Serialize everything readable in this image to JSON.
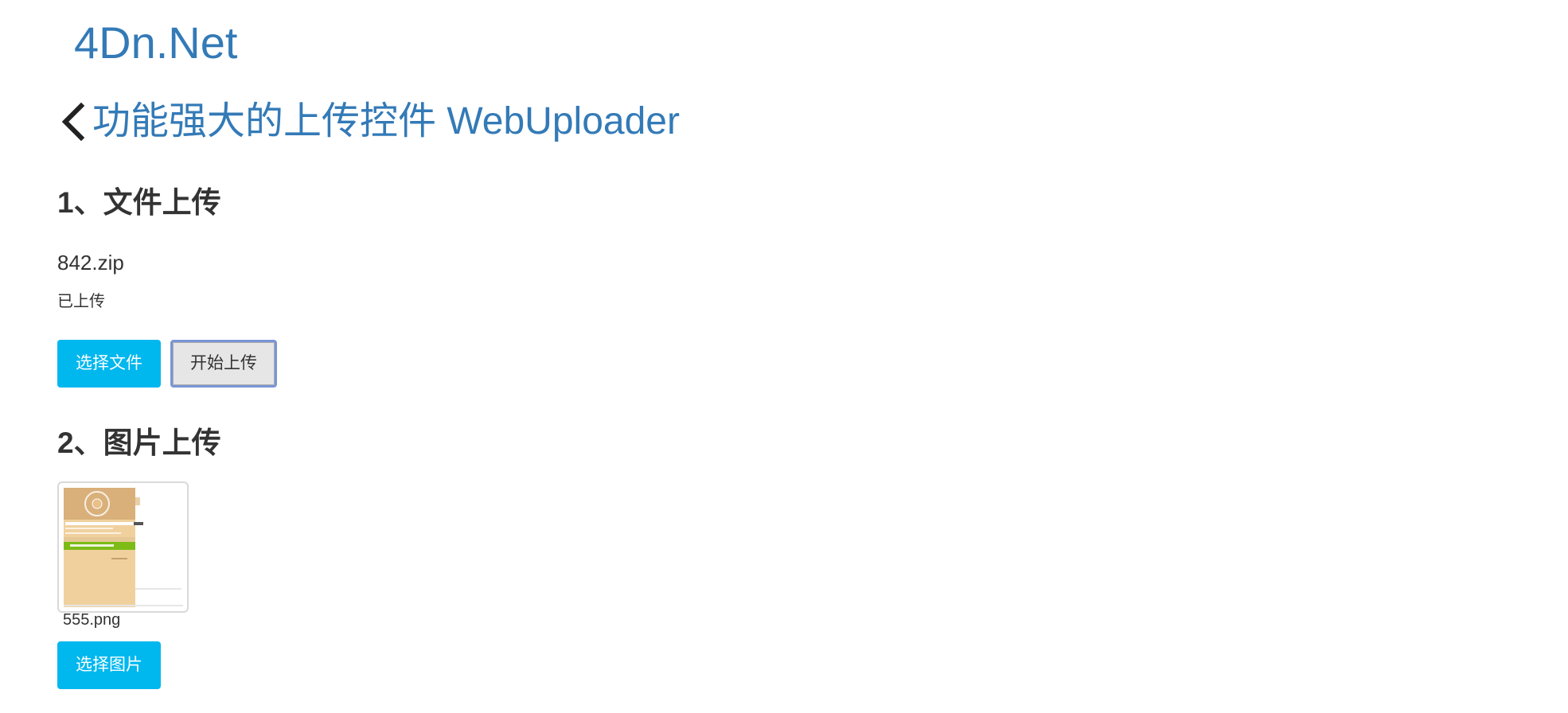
{
  "site": {
    "logo_text": "4Dn.Net"
  },
  "header": {
    "back_icon": "chevron-left-icon",
    "title": "功能强大的上传控件 WebUploader"
  },
  "file_upload": {
    "heading": "1、文件上传",
    "file_name": "842.zip",
    "status": "已上传",
    "select_button": "选择文件",
    "start_button": "开始上传"
  },
  "image_upload": {
    "heading": "2、图片上传",
    "thumbnail_name": "555.png",
    "select_button": "选择图片"
  },
  "colors": {
    "link": "#337ab7",
    "primary_button": "#00b7ee",
    "text": "#333333"
  }
}
